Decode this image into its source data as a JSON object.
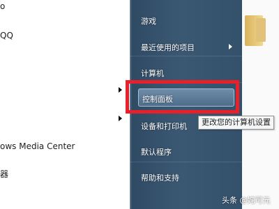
{
  "left_pane": {
    "items": [
      {
        "label": "o"
      },
      {
        "label": "QQ"
      },
      {
        "label": "ows Media Center"
      },
      {
        "label": "器"
      }
    ]
  },
  "start_menu": {
    "items": [
      {
        "label": "游戏"
      },
      {
        "label": "最近使用的项目",
        "has_submenu": true
      },
      {
        "label": "计算机"
      },
      {
        "label": "控制面板",
        "highlighted": true
      },
      {
        "label": "设备和打印机"
      },
      {
        "label": "默认程序"
      },
      {
        "label": "帮助和支持"
      }
    ]
  },
  "tooltip": {
    "text": "更改您的计算机设置"
  },
  "watermark": {
    "text": "头条 @姹可元"
  },
  "colors": {
    "menu_background": "#3b5873",
    "highlight": "#5f7f9d",
    "annotation_red": "#e8202a"
  }
}
